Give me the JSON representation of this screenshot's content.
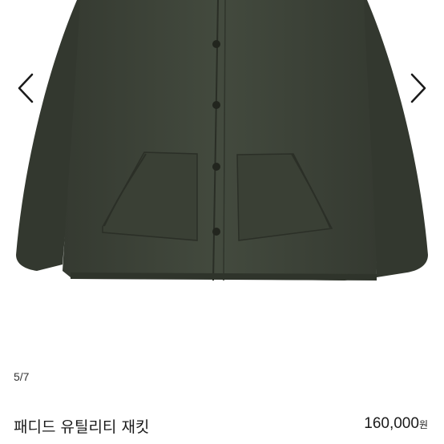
{
  "gallery": {
    "prev_icon": "chevron-left-icon",
    "next_icon": "chevron-right-icon",
    "photo_colors": {
      "jacket": "#3e4439",
      "jacket_dark": "#2f342b",
      "button": "#24271f"
    }
  },
  "pager": {
    "counter": "5/7"
  },
  "product": {
    "title": "패디드 유틸리티 재킷",
    "price": "160,000",
    "currency": "원"
  }
}
